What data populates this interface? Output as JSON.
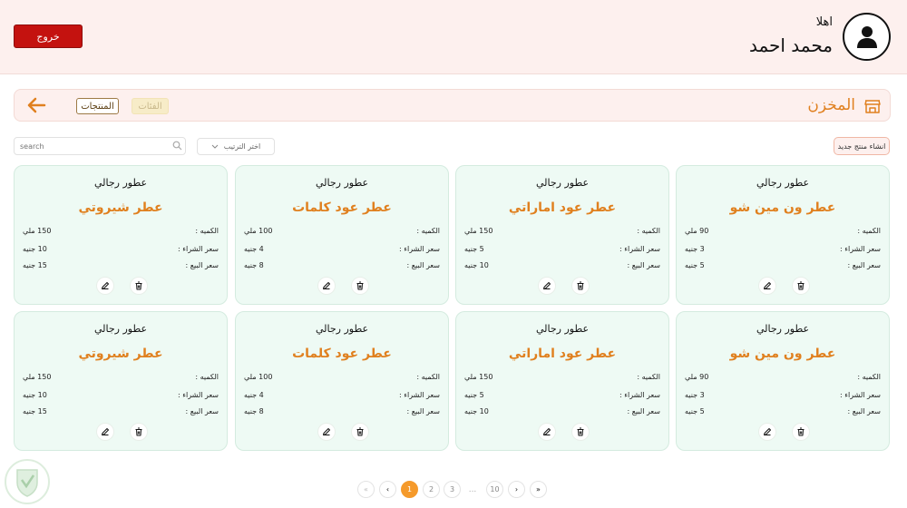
{
  "header": {
    "greeting": "اهلا",
    "user_name": "محمد احمد",
    "logout_label": "خروج",
    "avatar_icon": "user-avatar-icon"
  },
  "store": {
    "title": "المخزن",
    "title_icon": "store-icon",
    "back_icon": "arrow-left-icon",
    "tabs": [
      {
        "label": "المنتجات",
        "active": true
      },
      {
        "label": "الفئات",
        "active": false
      }
    ]
  },
  "controls": {
    "search_placeholder": "search",
    "sort_label": "اختر الترتيب",
    "new_product_label": "انشاء منتج جديد"
  },
  "labels": {
    "quantity": "الكميه :",
    "buy_price": "سعر الشراء :",
    "sell_price": "سعر البيع :"
  },
  "products": [
    {
      "category": "عطور رجالي",
      "name": "عطر ون مين شو",
      "quantity": "90 ملي",
      "buy_price": "3 جنيه",
      "sell_price": "5 جنيه"
    },
    {
      "category": "عطور رجالي",
      "name": "عطر عود اماراتي",
      "quantity": "150 ملي",
      "buy_price": "5 جنيه",
      "sell_price": "10 جنيه"
    },
    {
      "category": "عطور رجالي",
      "name": "عطر عود كلمات",
      "quantity": "100 ملي",
      "buy_price": "4 جنيه",
      "sell_price": "8 جنيه"
    },
    {
      "category": "عطور رجالي",
      "name": "عطر شيروتي",
      "quantity": "150 ملي",
      "buy_price": "10 جنيه",
      "sell_price": "15 جنيه"
    },
    {
      "category": "عطور رجالي",
      "name": "عطر ون مين شو",
      "quantity": "90 ملي",
      "buy_price": "3 جنيه",
      "sell_price": "5 جنيه"
    },
    {
      "category": "عطور رجالي",
      "name": "عطر عود اماراتي",
      "quantity": "150 ملي",
      "buy_price": "5 جنيه",
      "sell_price": "10 جنيه"
    },
    {
      "category": "عطور رجالي",
      "name": "عطر عود كلمات",
      "quantity": "100 ملي",
      "buy_price": "4 جنيه",
      "sell_price": "8 جنيه"
    },
    {
      "category": "عطور رجالي",
      "name": "عطر شيروتي",
      "quantity": "150 ملي",
      "buy_price": "10 جنيه",
      "sell_price": "15 جنيه"
    }
  ],
  "pagination": {
    "first": "«",
    "prev": "‹",
    "pages": [
      "1",
      "2",
      "3"
    ],
    "ellipsis": "...",
    "last_page": "10",
    "next": "›",
    "end": "»",
    "current": "1"
  },
  "colors": {
    "accent": "#e0801f",
    "logout": "#c4120f",
    "header_bg": "#fdf0ee",
    "card_bg": "#eefaf4",
    "active_page": "#f59a2b"
  }
}
